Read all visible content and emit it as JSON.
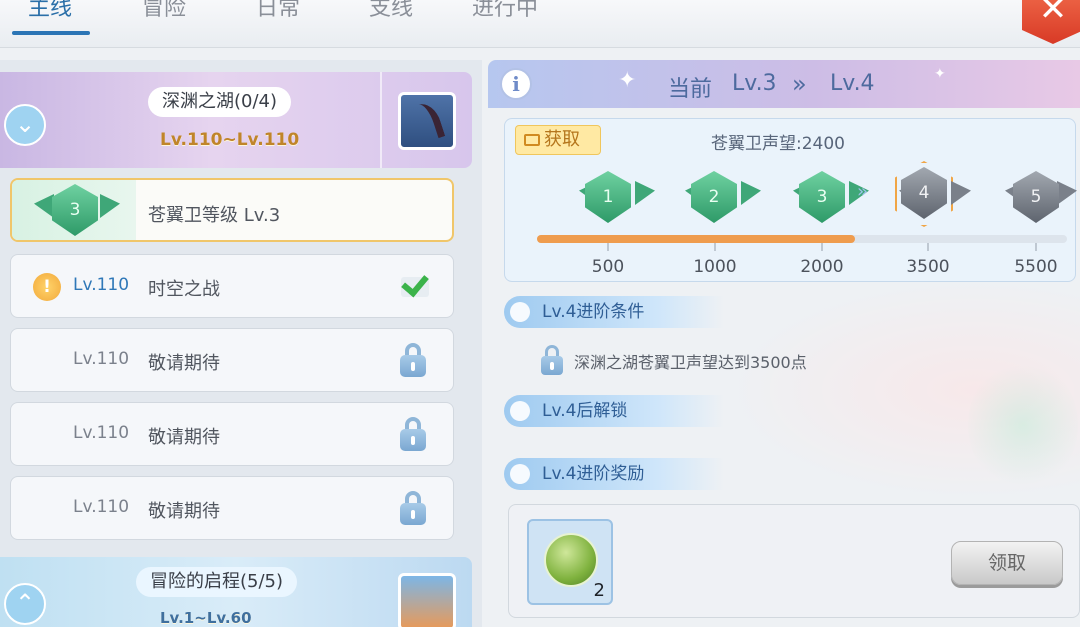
{
  "tabs": [
    {
      "label": "主线",
      "active": true
    },
    {
      "label": "冒险",
      "active": false
    },
    {
      "label": "日常",
      "active": false
    },
    {
      "label": "支线",
      "active": false
    },
    {
      "label": "进行中",
      "active": false
    }
  ],
  "close_label": "✕",
  "chapters": [
    {
      "title": "深渊之湖(0/4)",
      "range": "Lv.110~Lv.110",
      "expanded": true
    },
    {
      "title": "冒险的启程(5/5)",
      "range": "Lv.1~Lv.60",
      "expanded": false
    }
  ],
  "quests": [
    {
      "badge": "3",
      "name": "苍翼卫等级 Lv.3",
      "selected": true
    },
    {
      "level": "Lv.110",
      "name": "时空之战",
      "status": "completed",
      "alert": true
    },
    {
      "level": "Lv.110",
      "name": "敬请期待",
      "status": "locked"
    },
    {
      "level": "Lv.110",
      "name": "敬请期待",
      "status": "locked"
    },
    {
      "level": "Lv.110",
      "name": "敬请期待",
      "status": "locked"
    }
  ],
  "header": {
    "current_label": "当前",
    "from_level": "Lv.3",
    "chevrons": "»",
    "to_level": "Lv.4"
  },
  "progress": {
    "acquire_label": "获取",
    "reputation_text": "苍翼卫声望:2400",
    "current_value": 2400,
    "milestones": [
      {
        "level": "1",
        "value": "500",
        "reached": true
      },
      {
        "level": "2",
        "value": "1000",
        "reached": true
      },
      {
        "level": "3",
        "value": "2000",
        "reached": true
      },
      {
        "level": "4",
        "value": "3500",
        "reached": false,
        "next": true
      },
      {
        "level": "5",
        "value": "5500",
        "reached": false
      }
    ],
    "fill_fraction": 0.6
  },
  "sections": {
    "condition_title": "Lv.4进阶条件",
    "condition_text": "深渊之湖苍翼卫声望达到3500点",
    "unlock_title": "Lv.4后解锁",
    "reward_title": "Lv.4进阶奖励"
  },
  "reward": {
    "count": "2",
    "claim_label": "领取"
  },
  "colors": {
    "accent": "#2b75b5",
    "progress_fill": "#ef9c4e",
    "close": "#d83a26"
  }
}
